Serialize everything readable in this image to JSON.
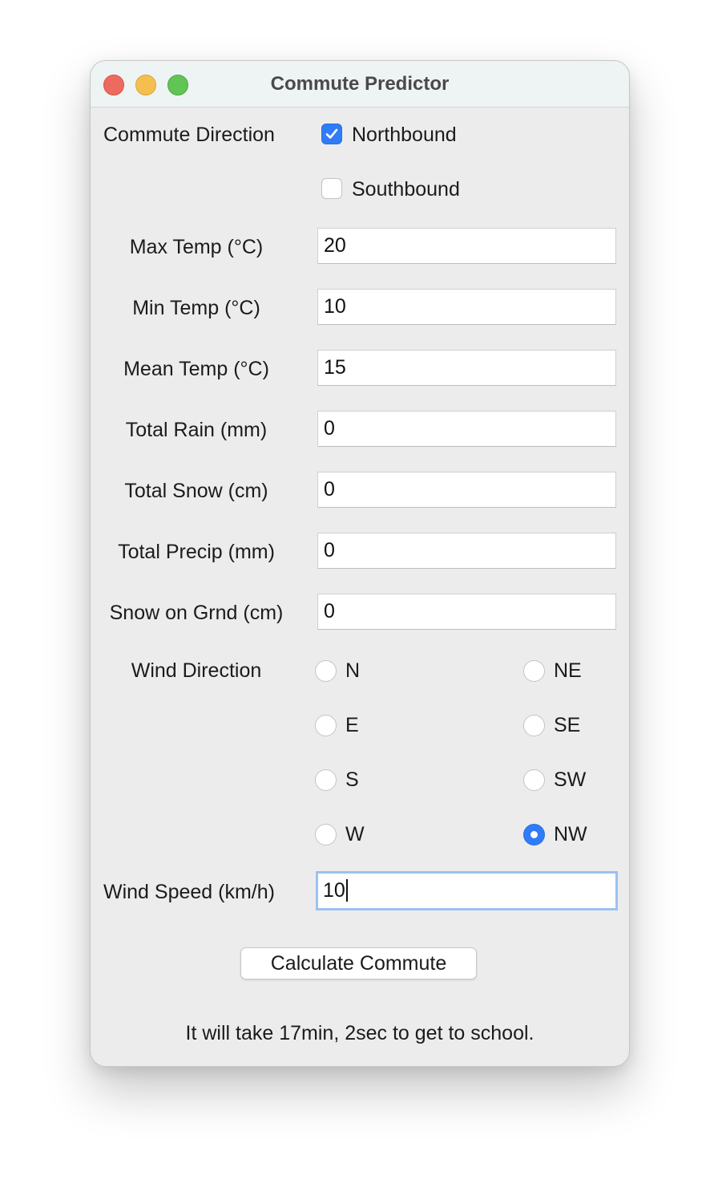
{
  "window": {
    "title": "Commute Predictor"
  },
  "direction": {
    "label": "Commute Direction",
    "options": [
      {
        "label": "Northbound",
        "checked": true
      },
      {
        "label": "Southbound",
        "checked": false
      }
    ]
  },
  "fields": [
    {
      "label": "Max Temp (°C)",
      "value": "20"
    },
    {
      "label": "Min Temp (°C)",
      "value": "10"
    },
    {
      "label": "Mean Temp (°C)",
      "value": "15"
    },
    {
      "label": "Total Rain (mm)",
      "value": "0"
    },
    {
      "label": "Total Snow (cm)",
      "value": "0"
    },
    {
      "label": "Total Precip (mm)",
      "value": "0"
    },
    {
      "label": "Snow on Grnd (cm)",
      "value": "0"
    }
  ],
  "wind_direction": {
    "label": "Wind Direction",
    "options": [
      "N",
      "NE",
      "E",
      "SE",
      "S",
      "SW",
      "W",
      "NW"
    ],
    "selected": "NW"
  },
  "wind_speed": {
    "label": "Wind Speed (km/h)",
    "value": "10"
  },
  "button": {
    "label": "Calculate Commute"
  },
  "result": {
    "text": "It will take 17min, 2sec to get to school."
  },
  "colors": {
    "accent": "#2f7cf6",
    "focus_ring": "#9cc1f3",
    "window_bg": "#ececec"
  }
}
